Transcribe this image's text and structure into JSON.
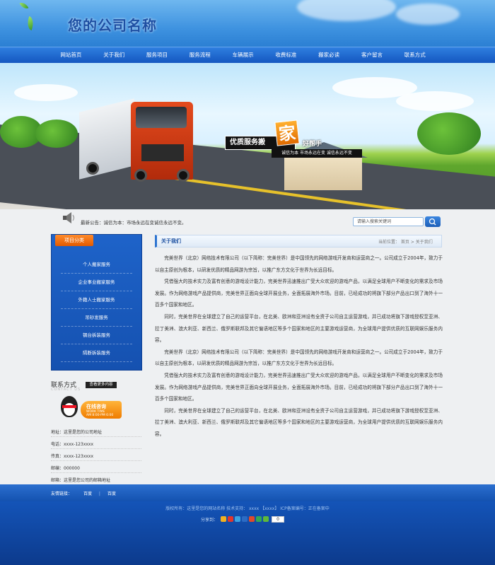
{
  "header": {
    "site_title": "您的公司名称"
  },
  "nav": [
    "网站首页",
    "关于我们",
    "服务项目",
    "服务流程",
    "车辆展示",
    "收费标准",
    "搬家必读",
    "客户留言",
    "联系方式"
  ],
  "banner": {
    "slogan_main": "优质服务搬",
    "slogan_char": "家",
    "slogan_tail": "好帮手",
    "slogan_sub": "诚信为本 市场永远在变 诚信永远不变"
  },
  "notice": {
    "text": "最新公告：诚信为本：市场永远在变诚信永远不变。"
  },
  "search": {
    "placeholder": "请输入搜索关键词"
  },
  "sidebar": {
    "category_title": "项目分类",
    "categories": [
      "个人搬家服务",
      "企业事业搬家服务",
      "外籍人士搬家服务",
      "吊砂发服务",
      "钢台拆装服务",
      "隔断拆装服务"
    ],
    "contact_title": "联系方式",
    "contact_en": "CONTACT US",
    "more_label": "查看更多内容",
    "qq_online": "在线咨询",
    "qq_time": "WORK TIME\nAM 8:00-PM 6:00",
    "contact_lines": [
      "地址：这里是您的公司地址",
      "电话：xxxx-123xxxx",
      "传真：xxxx-123xxxx",
      "邮编：000000",
      "邮箱：这里是您公司的邮箱地址"
    ]
  },
  "main": {
    "title": "关于我们",
    "breadcrumb": "当前位置： 首页 > 关于我们",
    "paragraphs": [
      "完美世界（北京）网络技术有限公司（以下简称：完美世界）是中国领先的网络游戏开发商和运营商之一。公司成立于2004年，致力于以自主原创为根本，以研发优质的精品网游为宗旨，以推广东方文化于世界为长远目标。",
      "凭借强大的技术实力及富有创意的游戏设计能力，完美世界迅速推出广受大众欢迎的游戏产品，以满足全球用户不断变化的需求及市场发展。作为网络游戏产品提供商，完美世界正面向全球开展业务，全面拓展海外市场。目前，已经成功的将旗下部分产品出口到了海外十一百多个国家和地区。",
      "同时，完美世界在全球建立了自己的运营平台，在北美、欧洲和亚洲设有全资子公司自主运营游戏，并已成功将旗下游戏授权至亚洲、拉丁美洲、澳大利亚、新西兰、俄罗斯联邦及其它偏语地区等多个国家和地区的主要游戏运营商，为全球用户提供优质的互联网娱乐服务内容。",
      "完美世界（北京）网络技术有限公司（以下简称：完美世界）是中国领先的网络游戏开发商和运营商之一。公司成立于2004年，致力于以自主原创为根本，以研发优质的精品网游为宗旨，以推广东方文化于世界为长远目标。",
      "凭借强大的技术实力及富有创意的游戏设计能力，完美世界迅速推出广受大众欢迎的游戏产品，以满足全球用户不断变化的需求及市场发展。作为网络游戏产品提供商，完美世界正面向全球开展业务，全面拓展海外市场。目前，已经成功的将旗下部分产品出口到了海外十一百多个国家和地区。",
      "同时，完美世界在全球建立了自己的运营平台，在北美、欧洲和亚洲设有全资子公司自主运营游戏，并已成功将旗下游戏授权至亚洲、拉丁美洲、澳大利亚、新西兰、俄罗斯联邦及其它偏语地区等多个国家和地区的主要游戏运营商，为全球用户提供优质的互联网娱乐服务内容。"
    ]
  },
  "footer": {
    "friend_links_label": "友情链接：",
    "friend_links": [
      "百度",
      "百度"
    ],
    "copyright": "版权所有：这里是您的网站名称   技术支持： xxxx 【xxxx】   ICP备案编号：正在备案中",
    "share_label": "分享到：",
    "share_icons": [
      {
        "name": "qzone-icon",
        "color": "#f2b01e"
      },
      {
        "name": "weibo-icon",
        "color": "#e2362b"
      },
      {
        "name": "tqq-icon",
        "color": "#39a3e0"
      },
      {
        "name": "renren-icon",
        "color": "#2c6bc4"
      },
      {
        "name": "kaixin-icon",
        "color": "#e04a2b"
      },
      {
        "name": "douban-icon",
        "color": "#34a853"
      },
      {
        "name": "more-icon",
        "color": "#5fb83a"
      }
    ],
    "share_count": "0"
  }
}
